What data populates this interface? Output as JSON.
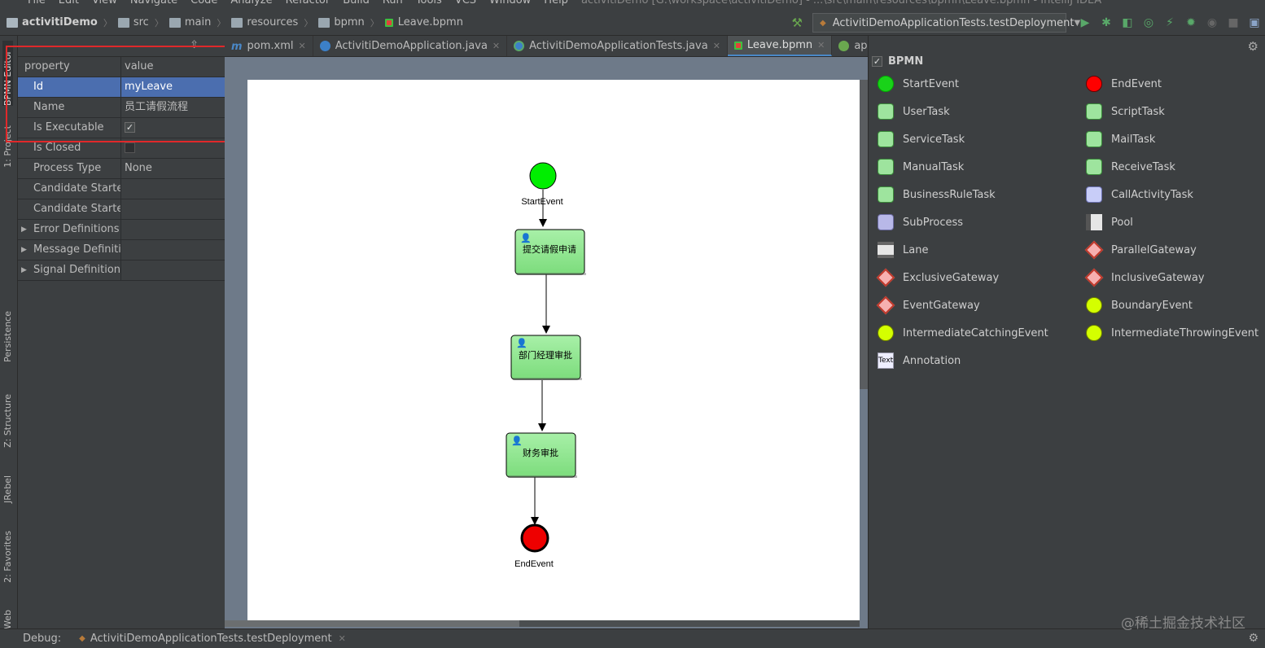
{
  "menu": [
    "File",
    "Edit",
    "View",
    "Navigate",
    "Code",
    "Analyze",
    "Refactor",
    "Build",
    "Run",
    "Tools",
    "VCS",
    "Window",
    "Help"
  ],
  "window_title": "activitiDemo [G:\\workspace\\activitiDemo] - ...\\src\\main\\resources\\bpmn\\Leave.bpmn - IntelliJ IDEA",
  "breadcrumbs": [
    "activitiDemo",
    "src",
    "main",
    "resources",
    "bpmn",
    "Leave.bpmn"
  ],
  "run_config": "ActivitiDemoApplicationTests.testDeployment",
  "left_stripe": [
    "BPMN Editor",
    "1: Project",
    "Persistence",
    "Z: Structure",
    "JRebel",
    "2: Favorites",
    "Web"
  ],
  "properties": {
    "col_property": "property",
    "col_value": "value",
    "rows": [
      {
        "k": "Id",
        "v": "myLeave",
        "sel": true
      },
      {
        "k": "Name",
        "v": "员工请假流程"
      },
      {
        "k": "Is Executable",
        "check": "on"
      },
      {
        "k": "Is Closed",
        "check": "off"
      },
      {
        "k": "Process Type",
        "v": "None"
      },
      {
        "k": "Candidate Starter",
        "v": ""
      },
      {
        "k": "Candidate Starter",
        "v": ""
      },
      {
        "k": "Error Definitions",
        "v": "",
        "exp": true
      },
      {
        "k": "Message Definitio",
        "v": "",
        "exp": true
      },
      {
        "k": "Signal Definitions",
        "v": "",
        "exp": true
      }
    ]
  },
  "tabs": [
    {
      "label": "pom.xml",
      "icon": "m"
    },
    {
      "label": "ActivitiDemoApplication.java",
      "icon": "c"
    },
    {
      "label": "ActivitiDemoApplicationTests.java",
      "icon": "t"
    },
    {
      "label": "Leave.bpmn",
      "icon": "b",
      "active": true
    },
    {
      "label": "applic",
      "icon": "a"
    }
  ],
  "diagram": {
    "start_label": "StartEvent",
    "end_label": "EndEvent",
    "tasks": [
      "提交请假申请",
      "部门经理审批",
      "财务审批"
    ],
    "colors": {
      "start": "#00ee00",
      "end": "#ee0000",
      "task": "#8fe88f"
    }
  },
  "palette": {
    "title": "BPMN",
    "items": [
      {
        "label": "StartEvent",
        "icon": "circle-green"
      },
      {
        "label": "EndEvent",
        "icon": "circle-red"
      },
      {
        "label": "UserTask",
        "icon": "task"
      },
      {
        "label": "ScriptTask",
        "icon": "task"
      },
      {
        "label": "ServiceTask",
        "icon": "task"
      },
      {
        "label": "MailTask",
        "icon": "task"
      },
      {
        "label": "ManualTask",
        "icon": "task"
      },
      {
        "label": "ReceiveTask",
        "icon": "task"
      },
      {
        "label": "BusinessRuleTask",
        "icon": "task"
      },
      {
        "label": "CallActivityTask",
        "icon": "task blue"
      },
      {
        "label": "SubProcess",
        "icon": "sub"
      },
      {
        "label": "Pool",
        "icon": "pool"
      },
      {
        "label": "Lane",
        "icon": "lane"
      },
      {
        "label": "ParallelGateway",
        "icon": "gw"
      },
      {
        "label": "ExclusiveGateway",
        "icon": "gw"
      },
      {
        "label": "InclusiveGateway",
        "icon": "gw"
      },
      {
        "label": "EventGateway",
        "icon": "gw"
      },
      {
        "label": "BoundaryEvent",
        "icon": "circle-lime"
      },
      {
        "label": "IntermediateCatchingEvent",
        "icon": "circle-lime"
      },
      {
        "label": "IntermediateThrowingEvent",
        "icon": "circle-lime"
      },
      {
        "label": "Annotation",
        "icon": "text",
        "glyph": "Text"
      }
    ]
  },
  "bottom": {
    "debug_label": "Debug:",
    "debug_session": "ActivitiDemoApplicationTests.testDeployment"
  },
  "watermark": "@稀土掘金技术社区"
}
